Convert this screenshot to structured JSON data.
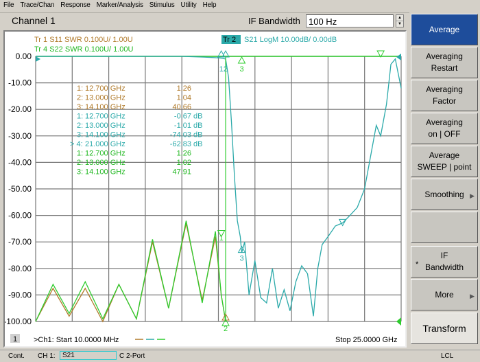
{
  "menubar": {
    "items": [
      "File",
      "Trace/Chan",
      "Response",
      "Marker/Analysis",
      "Stimulus",
      "Utility",
      "Help"
    ]
  },
  "channel": {
    "title": "Channel 1"
  },
  "ifbw": {
    "label": "IF Bandwidth",
    "value": "100 Hz"
  },
  "traces": {
    "tr1": "Tr  1  S11 SWR 0.100U/  1.00U",
    "tr4": "Tr  4  S22 SWR 0.100U/  1.00U",
    "tr2_badge": "Tr  2",
    "tr2": "S21 LogM 10.00dB/  0.00dB"
  },
  "colors": {
    "tr1": "#b07a2a",
    "tr2": "#2aa9a9",
    "tr4": "#2ecc2e",
    "active_softkey": "#1e4d9b"
  },
  "markers": [
    {
      "trace": "tr1",
      "num": "1:",
      "freq": "12.700 GHz",
      "val": "1.26"
    },
    {
      "trace": "tr1",
      "num": "2:",
      "freq": "13.000 GHz",
      "val": "1.04"
    },
    {
      "trace": "tr1",
      "num": "3:",
      "freq": "14.100 GHz",
      "val": "40.66"
    },
    {
      "trace": "tr2",
      "num": "1:",
      "freq": "12.700 GHz",
      "val": "-0.67 dB"
    },
    {
      "trace": "tr2",
      "num": "2:",
      "freq": "13.000 GHz",
      "val": "-1.01 dB"
    },
    {
      "trace": "tr2",
      "num": "3:",
      "freq": "14.100 GHz",
      "val": "-74.03 dB"
    },
    {
      "trace": "tr2",
      "num": "> 4:",
      "freq": "21.000 GHz",
      "val": "-62.83 dB"
    },
    {
      "trace": "tr4",
      "num": "1:",
      "freq": "12.700 GHz",
      "val": "1.26"
    },
    {
      "trace": "tr4",
      "num": "2:",
      "freq": "13.000 GHz",
      "val": "1.02"
    },
    {
      "trace": "tr4",
      "num": "3:",
      "freq": "14.100 GHz",
      "val": "47.91"
    }
  ],
  "chart_data": {
    "type": "line",
    "xlabel": "",
    "ylabel": "",
    "xlim_ghz": [
      0.01,
      25.0
    ],
    "ylim": [
      -100,
      0
    ],
    "yticks": [
      "0.00",
      "-10.00",
      "-20.00",
      "-30.00",
      "-40.00",
      "-50.00",
      "-60.00",
      "-70.00",
      "-80.00",
      "-90.00",
      "-100.00"
    ],
    "grid": true,
    "start_label": ">Ch1: Start  10.0000 MHz",
    "stop_label": "Stop  25.0000 GHz",
    "channel_num": "1",
    "marker_labels": {
      "m1": "1",
      "m2": "2",
      "m3": "3",
      "m12": "12"
    },
    "series": [
      {
        "name": "S21 LogM",
        "x": [
          0.01,
          2.5,
          5,
          7.5,
          10,
          11.5,
          12.3,
          12.7,
          13.0,
          13.2,
          13.4,
          13.6,
          13.8,
          14.0,
          14.1,
          14.3,
          14.6,
          15.0,
          15.4,
          15.8,
          16.2,
          16.6,
          17.0,
          17.4,
          17.8,
          18.2,
          18.6,
          19.0,
          19.3,
          19.6,
          20.0,
          20.5,
          21.0,
          21.5,
          22.0,
          22.5,
          23.0,
          23.3,
          23.6,
          24.0,
          24.3,
          24.6,
          25.0
        ],
        "y": [
          0,
          0,
          0,
          0,
          0,
          -0.3,
          -0.5,
          -0.67,
          -1.01,
          -8,
          -25,
          -45,
          -62,
          -68,
          -74.03,
          -70,
          -90,
          -77,
          -91,
          -93,
          -80,
          -95,
          -88,
          -96,
          -85,
          -79,
          -82,
          -98,
          -80,
          -71,
          -68,
          -64,
          -62.83,
          -60,
          -57,
          -50,
          -35,
          -26,
          -30,
          -18,
          -3,
          -1,
          -12
        ]
      },
      {
        "name": "S11 SWR",
        "x": [
          0.01,
          1.2,
          2.3,
          3.4,
          4.6,
          5.7,
          6.9,
          8.0,
          9.1,
          10.3,
          11.4,
          12.3,
          12.7,
          13.0
        ],
        "y": [
          -100,
          -87.5,
          -98,
          -87.5,
          -100,
          -86,
          -99,
          -70,
          -95,
          -63,
          -92,
          -68,
          -90,
          -100
        ]
      },
      {
        "name": "S22 SWR",
        "x": [
          0.01,
          1.2,
          2.3,
          3.4,
          4.6,
          5.7,
          6.9,
          8.0,
          9.1,
          10.3,
          11.4,
          12.3,
          12.7,
          13.0
        ],
        "y": [
          -100,
          -86,
          -97,
          -85,
          -99,
          -86,
          -99,
          -69,
          -95,
          -62,
          -93,
          -66,
          -90,
          -100
        ]
      }
    ]
  },
  "softkeys": [
    {
      "line1": "Average",
      "line2": ""
    },
    {
      "line1": "Averaging",
      "line2": "Restart"
    },
    {
      "line1": "Averaging",
      "line2": "Factor"
    },
    {
      "line1": "Averaging",
      "line2": "on | OFF"
    },
    {
      "line1": "Average",
      "line2": "SWEEP | point"
    },
    {
      "line1": "Smoothing",
      "line2": ""
    },
    {
      "line1": "",
      "line2": ""
    },
    {
      "line1": "IF",
      "line2": "Bandwidth"
    },
    {
      "line1": "More",
      "line2": ""
    },
    {
      "line1": "Transform",
      "line2": ""
    }
  ],
  "status": {
    "mode": "Cont.",
    "channel": "CH 1:",
    "param": "S21",
    "cal": "C  2-Port",
    "ref": "LCL"
  }
}
